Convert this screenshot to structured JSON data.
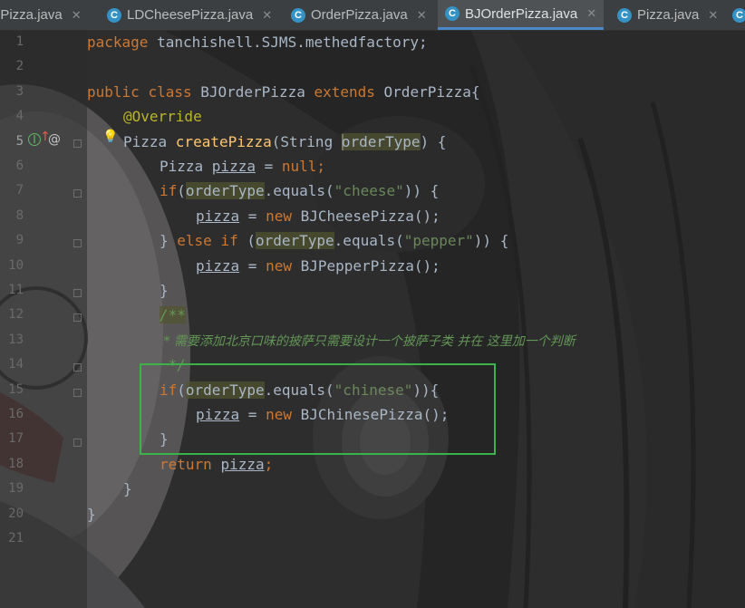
{
  "tabs": [
    {
      "label": "ePizza.java",
      "icon": "java-class-icon",
      "active": false,
      "close": "✕"
    },
    {
      "label": "LDCheesePizza.java",
      "icon": "java-class-icon",
      "active": false,
      "close": "✕"
    },
    {
      "label": "OrderPizza.java",
      "icon": "java-class-icon",
      "active": false,
      "close": "✕"
    },
    {
      "label": "BJOrderPizza.java",
      "icon": "java-class-icon",
      "active": true,
      "close": "✕"
    },
    {
      "label": "Pizza.java",
      "icon": "java-class-icon",
      "active": false,
      "close": "✕"
    }
  ],
  "tab_icon_letter": "C",
  "gutter": {
    "line_numbers": [
      "1",
      "2",
      "3",
      "4",
      "5",
      "6",
      "7",
      "8",
      "9",
      "10",
      "11",
      "12",
      "13",
      "14",
      "15",
      "16",
      "17",
      "18",
      "19",
      "20",
      "21"
    ],
    "current_line": "5",
    "override_marker": "I",
    "at_marker": "@"
  },
  "code": {
    "l1_kw": "package",
    "l1_rest": " tanchishell.SJMS.methedfactory;",
    "l3_kw1": "public",
    "l3_kw2": "class",
    "l3_name": " BJOrderPizza ",
    "l3_kw3": "extends",
    "l3_rest": " OrderPizza{",
    "l4_ann": "@Override",
    "l5_type": "Pizza ",
    "l5_fn": "createPizza",
    "l5_args1": "(String ",
    "l5_param": "orderType",
    "l5_args2": ") {",
    "l6_type": "Pizza ",
    "l6_var": "pizza",
    "l6_eq": " = ",
    "l6_null": "null",
    "l6_semi": ";",
    "l7_kw": "if",
    "l7_a": "(",
    "l7_p": "orderType",
    "l7_b": ".equals(",
    "l7_str": "\"cheese\"",
    "l7_c": ")) {",
    "l8_var": "pizza",
    "l8_eq": " = ",
    "l8_new": "new",
    "l8_rest": " BJCheesePizza();",
    "l9_a": "} ",
    "l9_else": "else",
    "l9_sp": " ",
    "l9_if": "if",
    "l9_b": " (",
    "l9_p": "orderType",
    "l9_c": ".equals(",
    "l9_str": "\"pepper\"",
    "l9_d": ")) {",
    "l10_var": "pizza",
    "l10_eq": " = ",
    "l10_new": "new",
    "l10_rest": " BJPepperPizza();",
    "l11": "}",
    "l12": "/**",
    "l13": " * 需要添加北京口味的披萨只需要设计一个披萨子类 并在 这里加一个判断",
    "l14": " */",
    "l15_kw": "if",
    "l15_a": "(",
    "l15_p": "orderType",
    "l15_b": ".equals(",
    "l15_str": "\"chinese\"",
    "l15_c": ")){",
    "l16_var": "pizza",
    "l16_eq": " = ",
    "l16_new": "new",
    "l16_rest": " BJChinesePizza();",
    "l17": "}",
    "l18_kw": "return",
    "l18_sp": " ",
    "l18_var": "pizza",
    "l18_semi": ";",
    "l19": "}",
    "l20": "}"
  },
  "colors": {
    "keyword": "#cc7832",
    "method": "#ffc66d",
    "string": "#6a8759",
    "annotation": "#bbb529",
    "comment": "#629755",
    "default": "#a9b7c6",
    "highlight_box": "#3cb34a",
    "active_tab_underline": "#4a88c7"
  }
}
